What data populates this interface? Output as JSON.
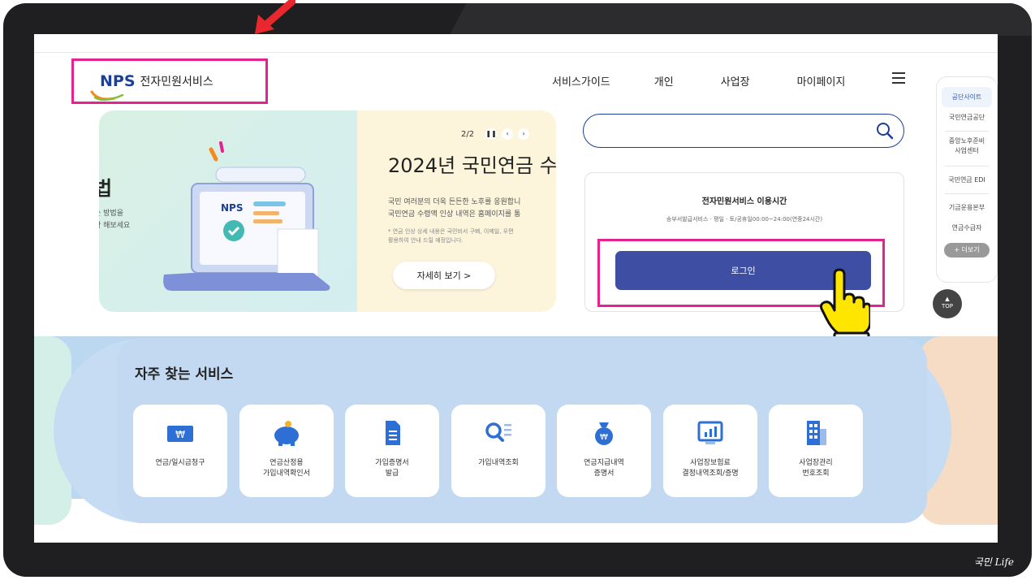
{
  "header": {
    "utility_text": "",
    "logo_mark": "NPS",
    "logo_text": "전자민원서비스",
    "nav": [
      "서비스가이드",
      "개인",
      "사업장",
      "마이페이지"
    ]
  },
  "banner": {
    "paging": "2/2",
    "title": "2024년 국민연금 수",
    "desc_lines": [
      "국민 여러분의 더욱 든든한 노후를 응원합니",
      "국민연금 수령액 인상 내역은 홈페이지를 통"
    ],
    "note_lines": [
      "* 연금 인상 상세 내용은 국민비서 구삐, 이메일, 우편",
      "  활용하여 안내 드릴 예정입니다."
    ],
    "more_label": "자세히 보기  >",
    "prev_slide_title": "법",
    "prev_slide_desc": [
      "는 방법을",
      "확 해보세요"
    ]
  },
  "search": {
    "placeholder": "",
    "value": ""
  },
  "login_card": {
    "title": "전자민원서비스 이용시간",
    "hours": "송부서발급서비스 · 평일 · 토/공휴일00:00~24:00(연중24시간)",
    "login_label": "로그인"
  },
  "quick_menu": {
    "items": [
      "공단사이트",
      "국민연금공단",
      "중앙노후준비 사업센터",
      "국민연금 EDI",
      "기금운용본부",
      "연금수급자"
    ],
    "more_label": "+ 더보기",
    "top_label": "TOP"
  },
  "services": {
    "title": "자주 찾는 서비스",
    "items": [
      {
        "label": "연금/일시금청구",
        "icon": "won-bill-icon"
      },
      {
        "label": "연금산정용\n가입내역확인서",
        "icon": "piggy-bank-icon"
      },
      {
        "label": "가입증명서\n발급",
        "icon": "document-icon"
      },
      {
        "label": "가입내역조회",
        "icon": "search-list-icon"
      },
      {
        "label": "연금지급내역\n증명서",
        "icon": "money-bag-icon"
      },
      {
        "label": "사업장보험료\n결정내역조회/증명",
        "icon": "chart-monitor-icon"
      },
      {
        "label": "사업장관리\n번호조회",
        "icon": "building-icon"
      }
    ]
  },
  "brand": "국민 Life",
  "colors": {
    "accent": "#3e4fa3",
    "highlight": "#e6228f",
    "nav_blue": "#1c3f97",
    "services_bg": "#c2d9f1"
  }
}
